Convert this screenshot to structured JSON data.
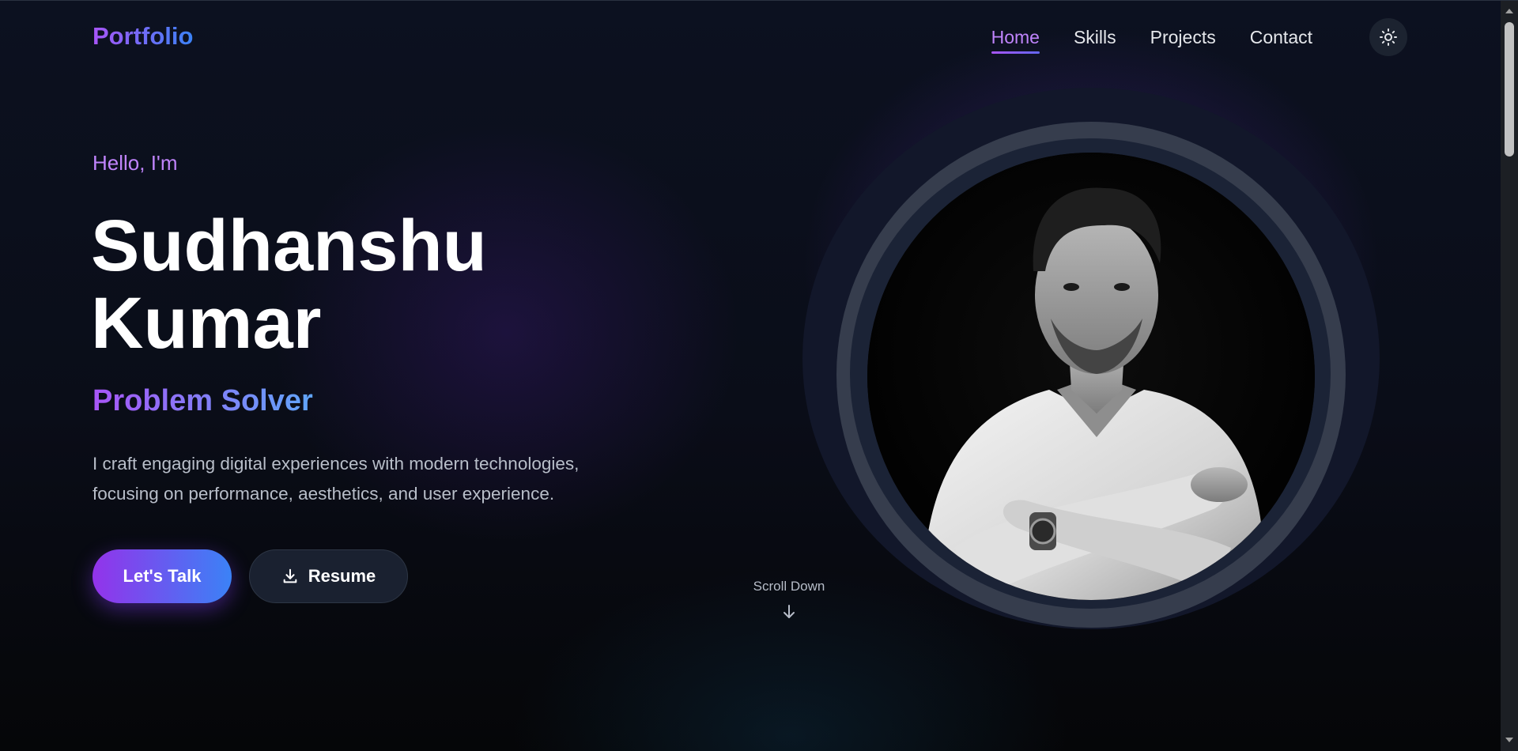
{
  "header": {
    "brand": "Portfolio",
    "nav": [
      {
        "label": "Home",
        "active": true
      },
      {
        "label": "Skills",
        "active": false
      },
      {
        "label": "Projects",
        "active": false
      },
      {
        "label": "Contact",
        "active": false
      }
    ],
    "theme_toggle_icon": "sun-icon"
  },
  "hero": {
    "greeting": "Hello, I'm",
    "first_name": "Sudhanshu",
    "last_name": "Kumar",
    "role": "Problem Solver",
    "description_line1": "I craft engaging digital experiences with modern technologies,",
    "description_line2": "focusing on performance, aesthetics, and user experience.",
    "cta_primary": "Let's Talk",
    "cta_secondary": "Resume",
    "cta_secondary_icon": "download-icon",
    "scroll_label": "Scroll Down",
    "scroll_icon": "arrow-down-icon"
  },
  "colors": {
    "accent_purple": "#a855f7",
    "accent_blue": "#3b82f6",
    "background": "#0a0d16"
  }
}
